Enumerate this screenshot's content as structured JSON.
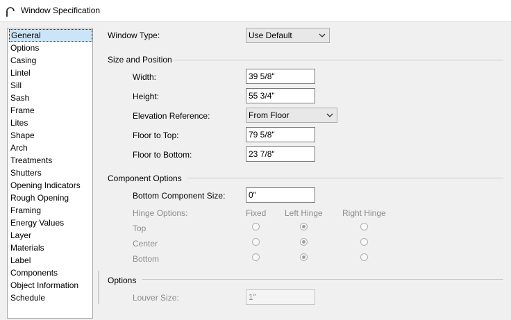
{
  "window": {
    "title": "Window Specification"
  },
  "sidebar": {
    "items": [
      {
        "label": "General"
      },
      {
        "label": "Options"
      },
      {
        "label": "Casing"
      },
      {
        "label": "Lintel"
      },
      {
        "label": "Sill"
      },
      {
        "label": "Sash"
      },
      {
        "label": "Frame"
      },
      {
        "label": "Lites"
      },
      {
        "label": "Shape"
      },
      {
        "label": "Arch"
      },
      {
        "label": "Treatments"
      },
      {
        "label": "Shutters"
      },
      {
        "label": "Opening Indicators"
      },
      {
        "label": "Rough Opening"
      },
      {
        "label": "Framing"
      },
      {
        "label": "Energy Values"
      },
      {
        "label": "Layer"
      },
      {
        "label": "Materials"
      },
      {
        "label": "Label"
      },
      {
        "label": "Components"
      },
      {
        "label": "Object Information"
      },
      {
        "label": "Schedule"
      }
    ],
    "selected": "General"
  },
  "general": {
    "window_type_label": "Window Type:",
    "window_type_value": "Use Default",
    "size_position": {
      "heading": "Size and Position",
      "width_label": "Width:",
      "width_value": "39 5/8\"",
      "height_label": "Height:",
      "height_value": "55 3/4\"",
      "elevation_reference_label": "Elevation Reference:",
      "elevation_reference_value": "From Floor",
      "floor_to_top_label": "Floor to Top:",
      "floor_to_top_value": "79 5/8\"",
      "floor_to_bottom_label": "Floor to Bottom:",
      "floor_to_bottom_value": "23 7/8\""
    },
    "component_options": {
      "heading": "Component Options",
      "bottom_component_size_label": "Bottom Component Size:",
      "bottom_component_size_value": "0\"",
      "hinge_options_label": "Hinge Options:",
      "columns": [
        "Fixed",
        "Left Hinge",
        "Right Hinge"
      ],
      "rows": [
        {
          "label": "Top",
          "selected": "Left Hinge"
        },
        {
          "label": "Center",
          "selected": "Left Hinge"
        },
        {
          "label": "Bottom",
          "selected": "Left Hinge"
        }
      ]
    },
    "options": {
      "heading": "Options",
      "louver_size_label": "Louver Size:",
      "louver_size_value": "1\""
    }
  }
}
